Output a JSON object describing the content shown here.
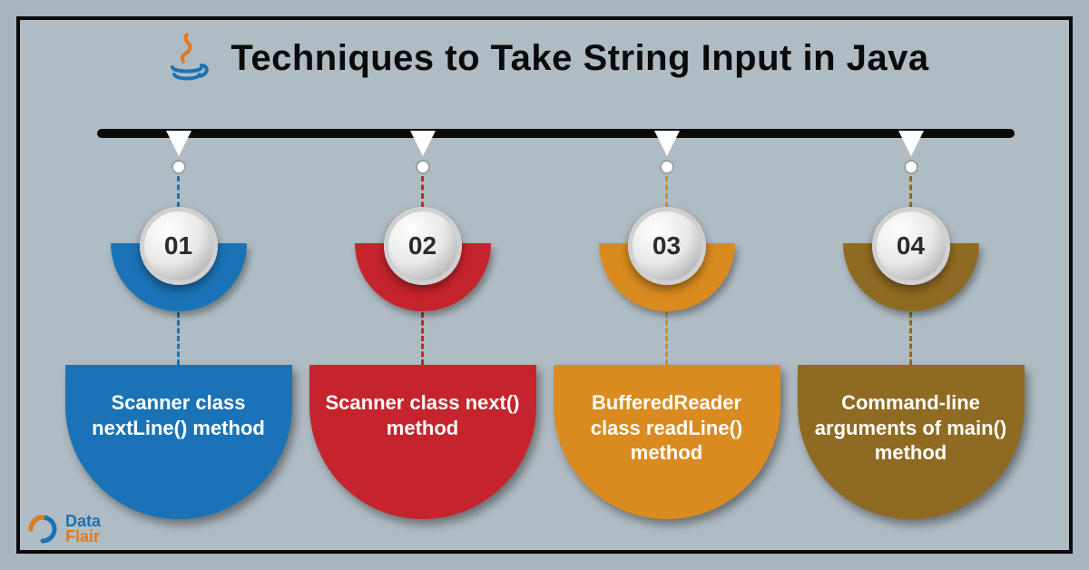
{
  "title": "Techniques to Take String Input in Java",
  "items": [
    {
      "num": "01",
      "label": "Scanner class nextLine() method"
    },
    {
      "num": "02",
      "label": "Scanner class next() method"
    },
    {
      "num": "03",
      "label": "BufferedReader class readLine() method"
    },
    {
      "num": "04",
      "label": "Command-line arguments of main() method"
    }
  ],
  "brand": {
    "top": "Data",
    "bot": "Flair"
  }
}
